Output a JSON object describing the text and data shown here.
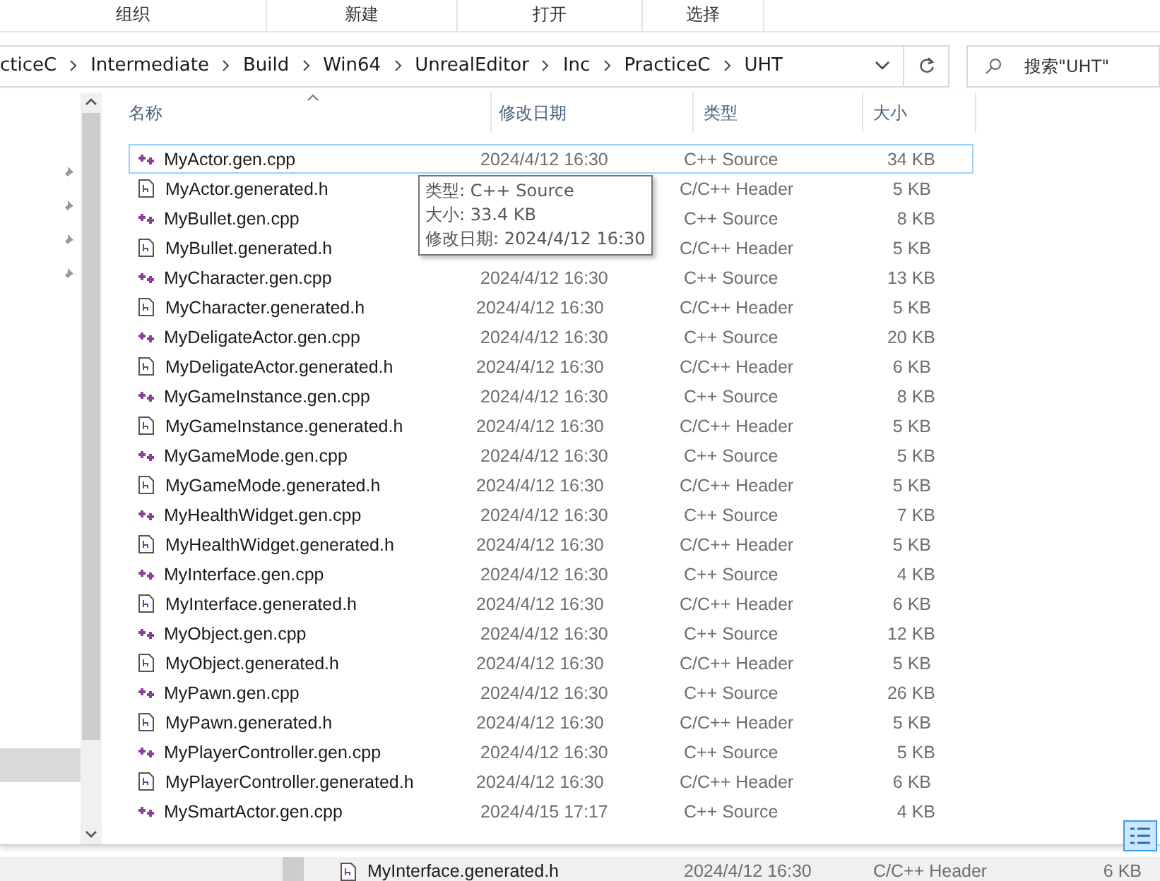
{
  "ribbon": {
    "groups": [
      "组织",
      "新建",
      "打开",
      "选择"
    ]
  },
  "address": {
    "crumbs": [
      "cticeC",
      "Intermediate",
      "Build",
      "Win64",
      "UnrealEditor",
      "Inc",
      "PracticeC",
      "UHT"
    ]
  },
  "search": {
    "placeholder": "搜索\"UHT\""
  },
  "columns": [
    {
      "label": "名称",
      "sorted": true
    },
    {
      "label": "修改日期",
      "sorted": false
    },
    {
      "label": "类型",
      "sorted": false
    },
    {
      "label": "大小",
      "sorted": false
    }
  ],
  "rows": [
    {
      "name": "MyActor.gen.cpp",
      "kind": "source",
      "date": "2024/4/12 16:30",
      "type": "C++ Source",
      "size": "34 KB",
      "selected": true
    },
    {
      "name": "MyActor.generated.h",
      "kind": "header",
      "type": "C/C++ Header",
      "size": "5 KB",
      "selected": false
    },
    {
      "name": "MyBullet.gen.cpp",
      "kind": "source",
      "type": "C++ Source",
      "size": "8 KB",
      "selected": false
    },
    {
      "name": "MyBullet.generated.h",
      "kind": "header",
      "type": "C/C++ Header",
      "size": "5 KB",
      "selected": false
    },
    {
      "name": "MyCharacter.gen.cpp",
      "kind": "source",
      "date": "2024/4/12 16:30",
      "type": "C++ Source",
      "size": "13 KB",
      "selected": false
    },
    {
      "name": "MyCharacter.generated.h",
      "kind": "header",
      "date": "2024/4/12 16:30",
      "type": "C/C++ Header",
      "size": "5 KB",
      "selected": false
    },
    {
      "name": "MyDeligateActor.gen.cpp",
      "kind": "source",
      "date": "2024/4/12 16:30",
      "type": "C++ Source",
      "size": "20 KB",
      "selected": false
    },
    {
      "name": "MyDeligateActor.generated.h",
      "kind": "header",
      "date": "2024/4/12 16:30",
      "type": "C/C++ Header",
      "size": "6 KB",
      "selected": false
    },
    {
      "name": "MyGameInstance.gen.cpp",
      "kind": "source",
      "date": "2024/4/12 16:30",
      "type": "C++ Source",
      "size": "8 KB",
      "selected": false
    },
    {
      "name": "MyGameInstance.generated.h",
      "kind": "header",
      "date": "2024/4/12 16:30",
      "type": "C/C++ Header",
      "size": "5 KB",
      "selected": false
    },
    {
      "name": "MyGameMode.gen.cpp",
      "kind": "source",
      "date": "2024/4/12 16:30",
      "type": "C++ Source",
      "size": "5 KB",
      "selected": false
    },
    {
      "name": "MyGameMode.generated.h",
      "kind": "header",
      "date": "2024/4/12 16:30",
      "type": "C/C++ Header",
      "size": "5 KB",
      "selected": false
    },
    {
      "name": "MyHealthWidget.gen.cpp",
      "kind": "source",
      "date": "2024/4/12 16:30",
      "type": "C++ Source",
      "size": "7 KB",
      "selected": false
    },
    {
      "name": "MyHealthWidget.generated.h",
      "kind": "header",
      "date": "2024/4/12 16:30",
      "type": "C/C++ Header",
      "size": "5 KB",
      "selected": false
    },
    {
      "name": "MyInterface.gen.cpp",
      "kind": "source",
      "date": "2024/4/12 16:30",
      "type": "C++ Source",
      "size": "4 KB",
      "selected": false
    },
    {
      "name": "MyInterface.generated.h",
      "kind": "header",
      "date": "2024/4/12 16:30",
      "type": "C/C++ Header",
      "size": "6 KB",
      "selected": false
    },
    {
      "name": "MyObject.gen.cpp",
      "kind": "source",
      "date": "2024/4/12 16:30",
      "type": "C++ Source",
      "size": "12 KB",
      "selected": false
    },
    {
      "name": "MyObject.generated.h",
      "kind": "header",
      "date": "2024/4/12 16:30",
      "type": "C/C++ Header",
      "size": "5 KB",
      "selected": false
    },
    {
      "name": "MyPawn.gen.cpp",
      "kind": "source",
      "date": "2024/4/12 16:30",
      "type": "C++ Source",
      "size": "26 KB",
      "selected": false
    },
    {
      "name": "MyPawn.generated.h",
      "kind": "header",
      "date": "2024/4/12 16:30",
      "type": "C/C++ Header",
      "size": "5 KB",
      "selected": false
    },
    {
      "name": "MyPlayerController.gen.cpp",
      "kind": "source",
      "date": "2024/4/12 16:30",
      "type": "C++ Source",
      "size": "5 KB",
      "selected": false
    },
    {
      "name": "MyPlayerController.generated.h",
      "kind": "header",
      "date": "2024/4/12 16:30",
      "type": "C/C++ Header",
      "size": "6 KB",
      "selected": false
    },
    {
      "name": "MySmartActor.gen.cpp",
      "kind": "source",
      "date": "2024/4/15 17:17",
      "type": "C++ Source",
      "size": "4 KB",
      "selected": false
    }
  ],
  "tooltip": {
    "lines": [
      "类型: C++ Source",
      "大小: 33.4 KB",
      "修改日期: 2024/4/12 16:30"
    ]
  },
  "nav": {
    "pinned_count_items": [
      {
        "selected": false
      },
      {
        "selected": false
      },
      {
        "selected": false
      },
      {
        "selected": false
      },
      {
        "selected": true
      }
    ]
  },
  "background_window": {
    "row": {
      "name": "MyInterface.generated.h",
      "kind": "header",
      "date": "2024/4/12 16:30",
      "type": "C/C++ Header",
      "size": "6 KB"
    }
  }
}
